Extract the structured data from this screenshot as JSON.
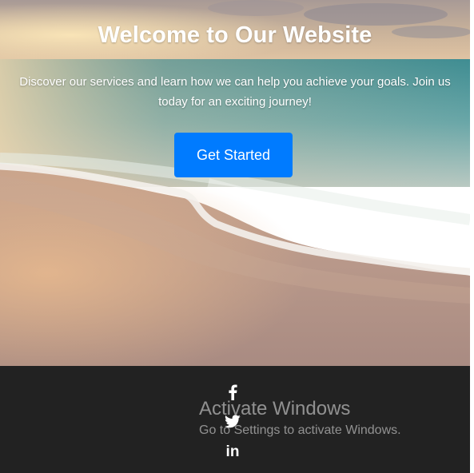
{
  "hero": {
    "title": "Welcome to Our Website",
    "description": "Discover our services and learn how we can help you achieve your goals. Join us today for an exciting journey!",
    "button_label": "Get Started",
    "button_color": "#007bff"
  },
  "footer": {
    "background": "#222222",
    "social_icons": [
      "facebook-icon",
      "twitter-icon",
      "linkedin-icon"
    ],
    "linkedin_glyph": "in"
  },
  "watermark": {
    "title": "Activate Windows",
    "subtitle": "Go to Settings to activate Windows."
  }
}
